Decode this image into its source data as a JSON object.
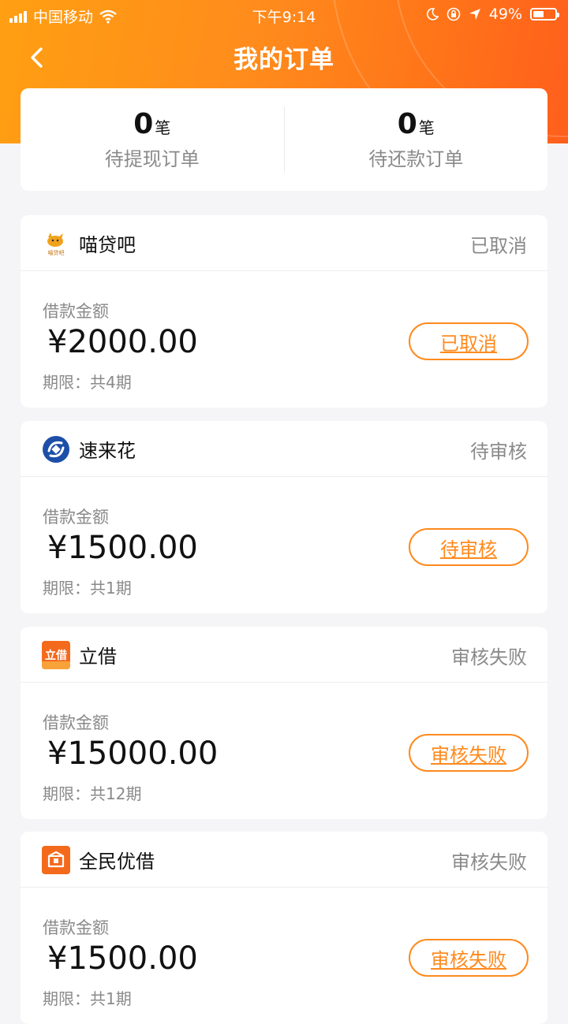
{
  "status_bar": {
    "carrier": "中国移动",
    "time": "下午9:14",
    "battery": "49%",
    "battery_level": 0.49
  },
  "nav": {
    "title": "我的订单"
  },
  "summary": [
    {
      "count": "0",
      "unit": "笔",
      "label": "待提现订单"
    },
    {
      "count": "0",
      "unit": "笔",
      "label": "待还款订单"
    }
  ],
  "orders": [
    {
      "lender": "喵贷吧",
      "logo_text": "喵贷吧",
      "status": "已取消",
      "amount_label": "借款金额",
      "amount": "¥2000.00",
      "term": "期限：共4期",
      "button": "已取消"
    },
    {
      "lender": "速来花",
      "status": "待审核",
      "amount_label": "借款金额",
      "amount": "¥1500.00",
      "term": "期限：共1期",
      "button": "待审核"
    },
    {
      "lender": "立借",
      "logo_text": "立借",
      "status": "审核失败",
      "amount_label": "借款金额",
      "amount": "¥15000.00",
      "term": "期限：共12期",
      "button": "审核失败"
    },
    {
      "lender": "全民优借",
      "status": "审核失败",
      "amount_label": "借款金额",
      "amount": "¥1500.00",
      "term": "期限：共1期",
      "button": "审核失败"
    }
  ],
  "colors": {
    "accent": "#ff8a1e",
    "header_start": "#ff9f12",
    "header_end": "#ff5f1c"
  }
}
